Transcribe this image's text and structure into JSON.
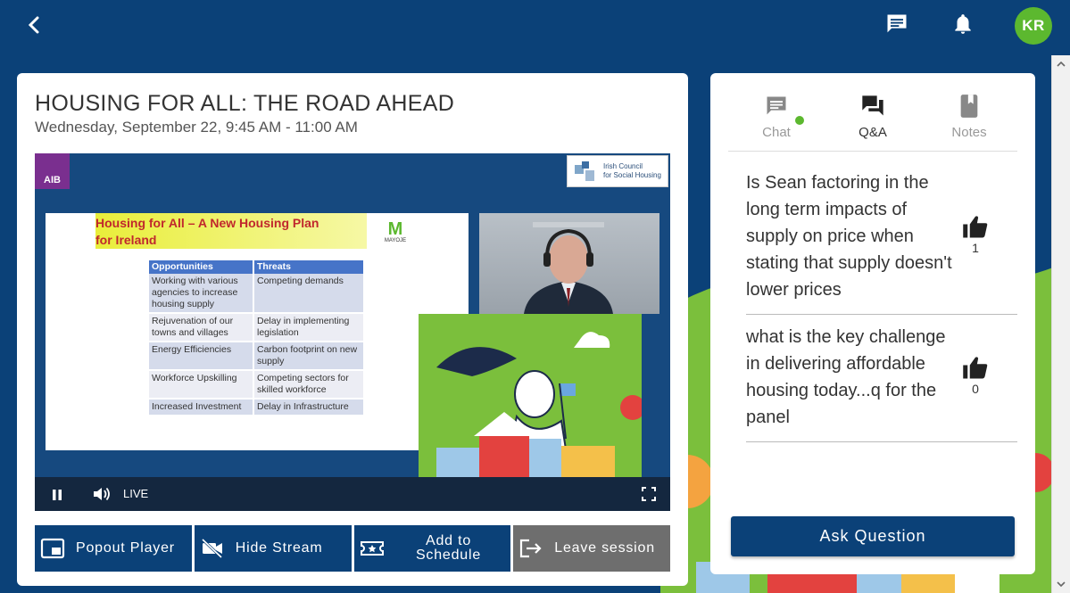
{
  "topbar": {
    "back_icon": "chevron-left-icon",
    "chat_icon": "chat-icon",
    "bell_icon": "bell-icon",
    "avatar_initials": "KR"
  },
  "session": {
    "title": "HOUSING FOR ALL: THE ROAD AHEAD",
    "time": "Wednesday, September 22, 9:45 AM - 11:00 AM"
  },
  "video": {
    "aib_logo": "AIB",
    "icsh_logo_line1": "Irish Council",
    "icsh_logo_line2": "for Social Housing",
    "slide_title_line1": "Housing for All – A New Housing Plan",
    "slide_title_line2": "for Ireland",
    "slide_logo": "MAYOJE",
    "table_headers": [
      "Opportunities",
      "Threats"
    ],
    "table_rows": [
      [
        "Working with various agencies to increase housing supply",
        "Competing demands"
      ],
      [
        "Rejuvenation of our towns and villages",
        "Delay in implementing legislation"
      ],
      [
        "Energy Efficiencies",
        "Carbon footprint on new supply"
      ],
      [
        "Workforce Upskilling",
        "Competing sectors for skilled workforce"
      ],
      [
        "Increased Investment",
        "Delay in Infrastructure"
      ]
    ],
    "live_label": "LIVE"
  },
  "actions": {
    "popout": "Popout Player",
    "hide_stream": "Hide Stream",
    "add_schedule_line1": "Add to",
    "add_schedule_line2": "Schedule",
    "leave": "Leave session"
  },
  "side": {
    "tabs": [
      {
        "label": "Chat",
        "icon": "chat-icon"
      },
      {
        "label": "Q&A",
        "icon": "forum-icon"
      },
      {
        "label": "Notes",
        "icon": "book-icon"
      }
    ],
    "active_tab": "Q&A",
    "questions": [
      {
        "text": "Is Sean factoring in the long term impacts of supply on price when stating that supply doesn't lower prices",
        "likes": "1"
      },
      {
        "text": "what is the key challenge in delivering affordable housing today...q for the panel",
        "likes": "0"
      }
    ],
    "ask_label": "Ask Question"
  },
  "colors": {
    "brand": "#0b4178",
    "accent_green": "#5cb82f",
    "leave_grey": "#6e6e6e"
  }
}
